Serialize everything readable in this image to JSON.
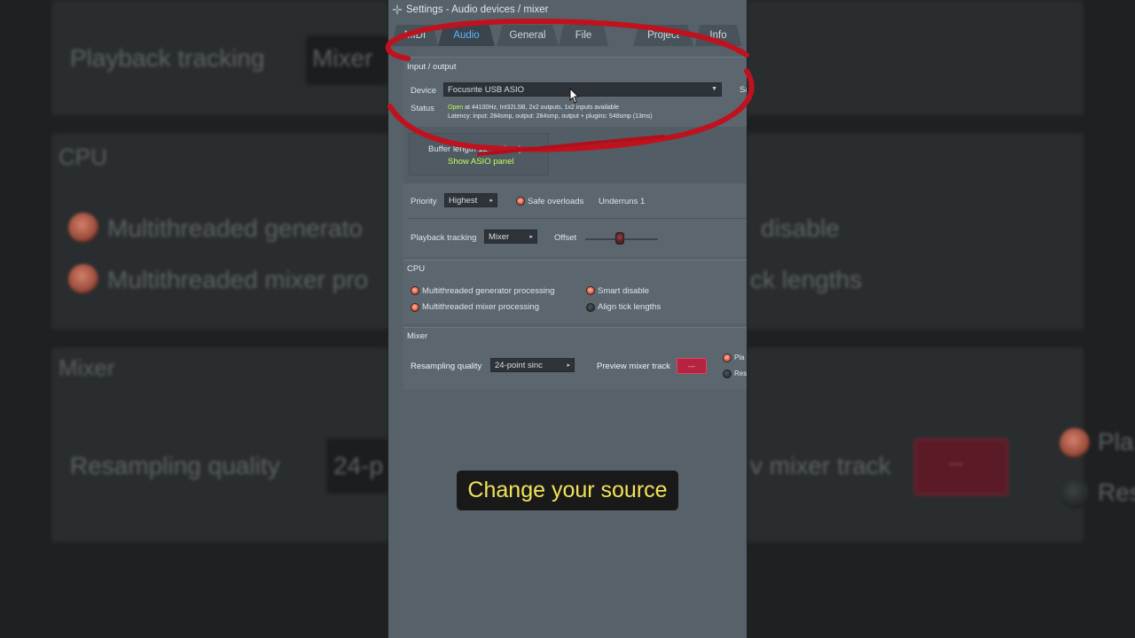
{
  "window": {
    "title": "Settings - Audio devices / mixer"
  },
  "tabs": [
    {
      "label": "MIDI",
      "active": false
    },
    {
      "label": "Audio",
      "active": true
    },
    {
      "label": "General",
      "active": false
    },
    {
      "label": "File",
      "active": false
    },
    {
      "label": "Project",
      "active": false
    },
    {
      "label": "Info",
      "active": false
    }
  ],
  "input_output": {
    "section_label": "Input / output",
    "device_label": "Device",
    "device_value": "Focusrite USB ASIO",
    "sample_rate_label_partial": "Sa",
    "status_label": "Status",
    "status_open": "Open",
    "status_line1_rest": " at 44100Hz, Int32LSB, 2x2 outputs, 1x2 inputs available",
    "status_line2": "Latency: input: 284smp, output: 284smp, output + plugins: 548smp (13ms)",
    "buffer_length_label": "Buffer length 12",
    "buffer_length_tail": "(3ms)",
    "show_asio_panel": "Show ASIO panel",
    "priority_label": "Priority",
    "priority_value": "Highest",
    "safe_overloads_label": "Safe overloads",
    "underruns_label": "Underruns 1",
    "playback_tracking_label": "Playback tracking",
    "playback_tracking_value": "Mixer",
    "offset_label": "Offset"
  },
  "cpu": {
    "section_label": "CPU",
    "multithreaded_generator": "Multithreaded generator processing",
    "multithreaded_mixer": "Multithreaded mixer processing",
    "smart_disable": "Smart disable",
    "align_tick_lengths": "Align tick lengths"
  },
  "mixer": {
    "section_label": "Mixer",
    "resampling_quality_label": "Resampling quality",
    "resampling_quality_value": "24-point sinc",
    "preview_mixer_track_label": "Preview mixer track",
    "preview_mixer_track_value": "---",
    "option1_partial": "Pla",
    "option2_partial": "Res"
  },
  "background": {
    "playback_tracking": "Playback tracking",
    "mixer_value": "Mixer",
    "cpu": "CPU",
    "multithreaded_generator_partial": "Multithreaded generato",
    "multithreaded_mixer_partial": "Multithreaded mixer pro",
    "disable_partial": "disable",
    "tick_lengths_partial": "ck lengths",
    "mixer": "Mixer",
    "resampling_quality": "Resampling quality",
    "resampling_value_partial": "24-p",
    "preview_partial": "v mixer track",
    "preview_value": "---",
    "play_partial": "Pla",
    "res_partial": "Res"
  },
  "caption": "Change your source",
  "colors": {
    "accent_tab": "#5fb2ff",
    "status_green": "#b8ff4a",
    "annotation_red": "#c0121e",
    "caption_text": "#f2e25a"
  }
}
